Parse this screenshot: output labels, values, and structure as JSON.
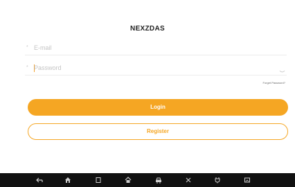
{
  "app": {
    "title": "NEXZDAS"
  },
  "login_form": {
    "email": {
      "required_mark": "*",
      "placeholder": "E-mail",
      "value": ""
    },
    "password": {
      "required_mark": "*",
      "placeholder": "Password",
      "value": ""
    },
    "forgot_label": "Forget Password?",
    "login_label": "Login",
    "register_label": "Register"
  },
  "navbar": {
    "icons": [
      "back-icon",
      "home-icon",
      "recent-apps-icon",
      "house-icon",
      "car-icon",
      "tools-icon",
      "vci-icon",
      "screenshot-icon"
    ]
  },
  "colors": {
    "accent": "#f5a623",
    "navbar": "#111111"
  }
}
